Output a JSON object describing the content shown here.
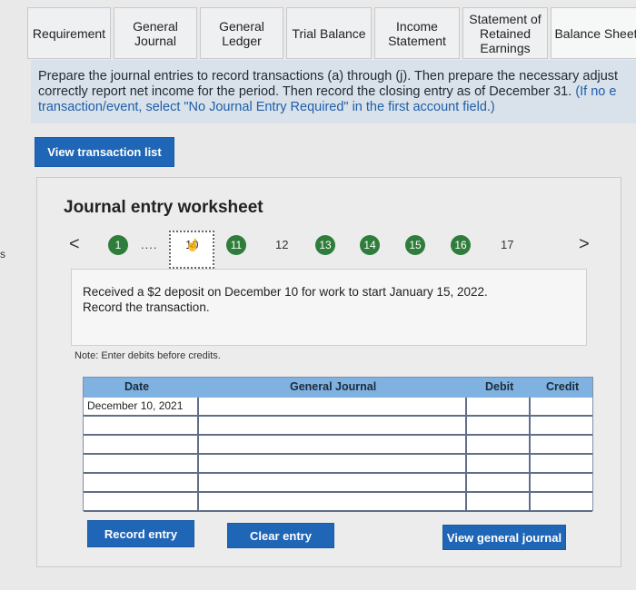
{
  "tabs": [
    {
      "label": "Requirement"
    },
    {
      "label": "General\nJournal"
    },
    {
      "label": "General\nLedger"
    },
    {
      "label": "Trial Balance"
    },
    {
      "label": "Income\nStatement"
    },
    {
      "label": "Statement of\nRetained\nEarnings"
    },
    {
      "label": "Balance Sheet"
    }
  ],
  "instructions": {
    "line1": "Prepare the journal entries to record transactions (a) through (j). Then prepare the necessary adjust",
    "line2_a": "correctly report net income for the period. Then record the closing entry as of December 31. ",
    "line2_b": "(If no e",
    "line3": "transaction/event, select \"No Journal Entry Required\" in the first account field.)"
  },
  "side_text": "s",
  "view_transactions_label": "View transaction list",
  "worksheet": {
    "title": "Journal entry worksheet",
    "prev_arrow": "<",
    "next_arrow": ">",
    "first_step": "1",
    "dots": "....",
    "current_step": "10",
    "steps": [
      "11",
      "12",
      "13",
      "14",
      "15",
      "16",
      "17"
    ],
    "completed_steps": [
      "1",
      "11",
      "13",
      "14",
      "15",
      "16"
    ],
    "description": "Received a $2 deposit on December 10 for work to start January 15, 2022.\nRecord the transaction.",
    "note": "Note: Enter debits before credits."
  },
  "journal_table": {
    "headers": {
      "date": "Date",
      "account": "General Journal",
      "debit": "Debit",
      "credit": "Credit"
    },
    "rows": [
      {
        "date": "December 10, 2021",
        "account": "",
        "debit": "",
        "credit": ""
      },
      {
        "date": "",
        "account": "",
        "debit": "",
        "credit": ""
      },
      {
        "date": "",
        "account": "",
        "debit": "",
        "credit": ""
      },
      {
        "date": "",
        "account": "",
        "debit": "",
        "credit": ""
      },
      {
        "date": "",
        "account": "",
        "debit": "",
        "credit": ""
      },
      {
        "date": "",
        "account": "",
        "debit": "",
        "credit": ""
      }
    ]
  },
  "buttons": {
    "record": "Record entry",
    "clear": "Clear entry",
    "view_journal": "View general journal"
  },
  "colors": {
    "button_blue": "#1f66b7",
    "step_complete_green": "#2f7d3b",
    "table_header": "#7fb2e0",
    "instruction_bg": "#d9e2ea"
  }
}
